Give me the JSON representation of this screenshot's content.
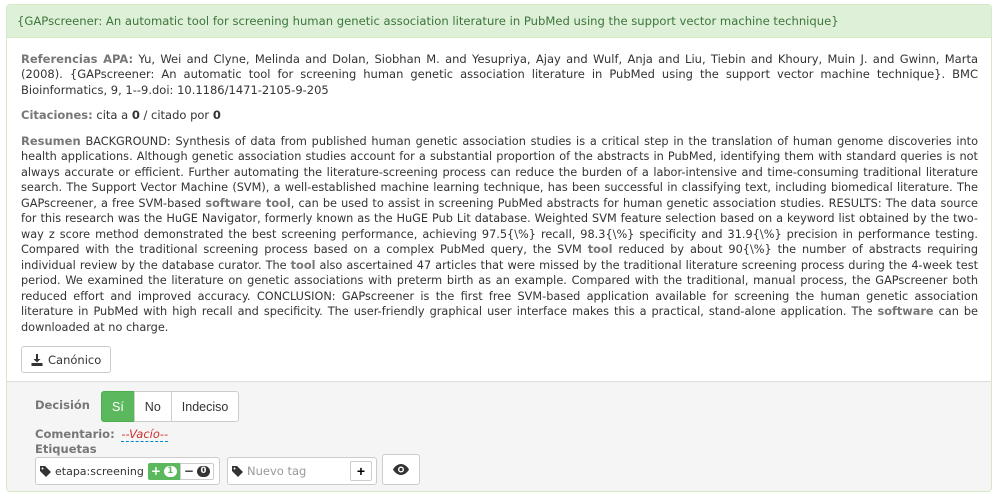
{
  "title": "{GAPscreener: An automatic tool for screening human genetic association literature in PubMed using the support vector machine technique}",
  "apa": {
    "label": "Referencias APA:",
    "text": "Yu, Wei and Clyne, Melinda and Dolan, Siobhan M. and Yesupriya, Ajay and Wulf, Anja and Liu, Tiebin and Khoury, Muin J. and Gwinn, Marta (2008). {GAPscreener: An automatic tool for screening human genetic association literature in PubMed using the support vector machine technique}. BMC Bioinformatics, 9, 1--9.doi: 10.1186/1471-2105-9-205"
  },
  "citations": {
    "label": "Citaciones:",
    "cites_prefix": "cita a",
    "cites_count": "0",
    "separator": "/ citado por",
    "cited_by_count": "0"
  },
  "abstract": {
    "label": "Resumen",
    "p1": "BACKGROUND: Synthesis of data from published human genetic association studies is a critical step in the translation of human genome discoveries into health applications. Although genetic association studies account for a substantial proportion of the abstracts in PubMed, identifying them with standard queries is not always accurate or efficient. Further automating the literature-screening process can reduce the burden of a labor-intensive and time-consuming traditional literature search. The Support Vector Machine (SVM), a well-established machine learning technique, has been successful in classifying text, including biomedical literature. The GAPscreener, a free SVM-based",
    "h1": "software tool",
    "p2": ", can be used to assist in screening PubMed abstracts for human genetic association studies. RESULTS: The data source for this research was the HuGE Navigator, formerly known as the HuGE Pub Lit database. Weighted SVM feature selection based on a keyword list obtained by the two-way z score method demonstrated the best screening performance, achieving 97.5{\\%} recall, 98.3{\\%} specificity and 31.9{\\%} precision in performance testing. Compared with the traditional screening process based on a complex PubMed query, the SVM",
    "h2": "tool",
    "p3": "reduced by about 90{\\%} the number of abstracts requiring individual review by the database curator. The",
    "h3": "tool",
    "p4": "also ascertained 47 articles that were missed by the traditional literature screening process during the 4-week test period. We examined the literature on genetic associations with preterm birth as an example. Compared with the traditional, manual process, the GAPscreener both reduced effort and improved accuracy. CONCLUSION: GAPscreener is the first free SVM-based application available for screening the human genetic association literature in PubMed with high recall and specificity. The user-friendly graphical user interface makes this a practical, stand-alone application. The",
    "h4": "software",
    "p5": "can be downloaded at no charge."
  },
  "canonical_button": {
    "label": "Canónico",
    "icon": "download-icon"
  },
  "decision": {
    "label": "Decisión",
    "options": [
      "Sí",
      "No",
      "Indeciso"
    ],
    "selected": "Sí"
  },
  "comment": {
    "label": "Comentario:",
    "value": "--Vacío--"
  },
  "tags": {
    "label": "Etiquetas",
    "existing": {
      "name": "etapa:screening",
      "plus_count": "1",
      "minus_count": "0"
    },
    "new_placeholder": "Nuevo tag"
  },
  "colors": {
    "heading_bg": "#dff0d8",
    "heading_text": "#3c763d",
    "success": "#5cb85c",
    "comment_empty": "#c9302c"
  }
}
